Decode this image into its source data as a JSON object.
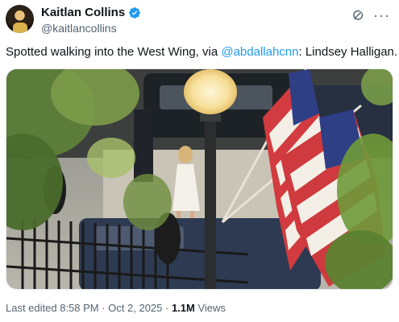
{
  "author": {
    "display_name": "Kaitlan Collins",
    "handle": "@kaitlancollins",
    "verified": true,
    "verified_badge_color": "#1d9bf0"
  },
  "actions": {
    "grok_icon": "grok-icon",
    "more_icon": "more-icon",
    "more_glyph": "···"
  },
  "tweet": {
    "text_before": "Spotted walking into the West Wing, via ",
    "mention": "@abdallahcnn",
    "text_after": ": Lindsey Halligan.",
    "mention_color": "#1d9bf0"
  },
  "media": {
    "type": "photo"
  },
  "meta": {
    "edited_label": "Last edited 8:58 PM · Oct 2, 2025 · ",
    "views_count": "1.1M",
    "views_label": " Views"
  }
}
